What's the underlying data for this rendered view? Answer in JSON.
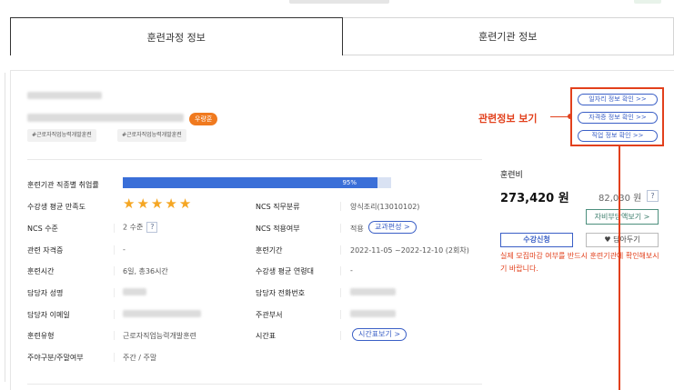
{
  "tabs": [
    {
      "label": "훈련과정 정보",
      "active": true
    },
    {
      "label": "훈련기관 정보",
      "active": false
    }
  ],
  "course": {
    "badge": "우량훈",
    "tags": [
      "#근로자직업능력개발훈련",
      "#근로자직업능력개발훈련"
    ]
  },
  "employment_rate": {
    "label": "훈련기관 직종별 취업률",
    "value": 95,
    "text": "95%"
  },
  "rows": {
    "satisfaction": {
      "label": "수강생 평균 만족도",
      "stars": 5
    },
    "ncs_level": {
      "label": "NCS 수준",
      "value": "2 수준",
      "help": "?"
    },
    "qualification": {
      "label": "관련 자격증",
      "value": "-"
    },
    "training_time": {
      "label": "훈련시간",
      "value": "6일, 총36시간"
    },
    "manager_name": {
      "label": "담당자 성명"
    },
    "manager_email": {
      "label": "담당자 이메일"
    },
    "training_type": {
      "label": "훈련유형",
      "value": "근로자직업능력개발훈련"
    },
    "day_type": {
      "label": "주야구분/주말여부",
      "value": "주간 / 주말"
    },
    "ncs_category": {
      "label": "NCS 직무분류",
      "value": "양식조리(13010102)"
    },
    "ncs_applied": {
      "label": "NCS 적용여부",
      "value": "적용",
      "button": "교과편성 >"
    },
    "period": {
      "label": "훈련기간",
      "value": "2022-11-05 ~2022-12-10 (2회차)"
    },
    "avg_age": {
      "label": "수강생 평균 연령대",
      "value": "-"
    },
    "manager_phone": {
      "label": "담당자 전화번호"
    },
    "department": {
      "label": "주관부서"
    },
    "schedule": {
      "label": "시간표",
      "button": "시간표보기 >"
    }
  },
  "fee": {
    "label": "훈련비",
    "main": "273,420 원",
    "sub": "82,030 원",
    "help": "?",
    "self_pay_button": "자비부담액보기 >",
    "apply_button": "수강신청",
    "fav_button": "담아두기",
    "notice": "실제 모집마감 여부를 반드시 훈련기관에 확인해보시기 바랍니다."
  },
  "callout": {
    "label": "관련정보 보기",
    "links": [
      "일자리 정보 확인 >>",
      "자격증 정보 확인 >>",
      "직업 정보 확인 >>"
    ]
  },
  "colors": {
    "accent_red": "#e2401c",
    "bar_blue": "#3a6fd8",
    "star": "#f5a623",
    "badge_orange": "#f07a1f"
  }
}
